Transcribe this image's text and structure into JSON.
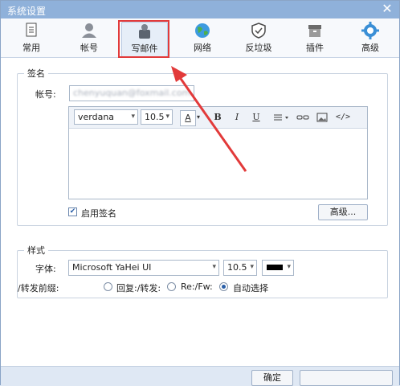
{
  "window": {
    "title": "系统设置",
    "close_glyph": "✕"
  },
  "toolbar": {
    "tabs": [
      {
        "label": "常用",
        "icon": "document-icon"
      },
      {
        "label": "帐号",
        "icon": "user-icon"
      },
      {
        "label": "写邮件",
        "icon": "compose-icon"
      },
      {
        "label": "网络",
        "icon": "globe-icon"
      },
      {
        "label": "反垃圾",
        "icon": "shield-icon"
      },
      {
        "label": "插件",
        "icon": "box-icon"
      },
      {
        "label": "高级",
        "icon": "gear-icon"
      }
    ],
    "active_tab": "写邮件"
  },
  "signature": {
    "section_title": "签名",
    "account_label": "帐号:",
    "account_value": "chenyuquan@foxmail.com",
    "font_value": "verdana",
    "size_value": "10.5",
    "bold": "B",
    "italic": "I",
    "underline": "U",
    "font_color_glyph": "A",
    "enable_label": "启用签名",
    "enabled": true,
    "advanced_button": "高级..."
  },
  "style": {
    "section_title": "样式",
    "font_label": "字体:",
    "font_value": "Microsoft YaHei UI",
    "size_value": "10.5",
    "prefix_label": "/转发前缀:",
    "options": [
      "回复:/转发:",
      "Re:/Fw:",
      "自动选择"
    ],
    "selected_option": "自动选择"
  },
  "footer": {
    "ok_button": "确定",
    "cancel_button": ""
  },
  "colors": {
    "annotation_red": "#e23a3a",
    "accent_blue": "#2a5fa8",
    "titlebar": "#8fb1da"
  }
}
